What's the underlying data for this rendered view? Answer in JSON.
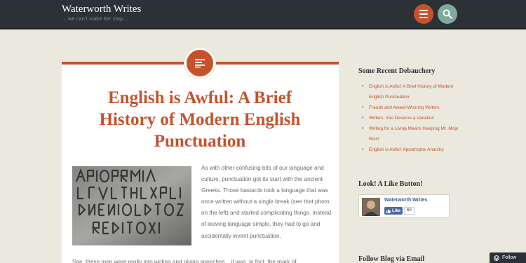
{
  "site": {
    "title": "Waterworth Writes",
    "tagline": "... we can't make her stop...."
  },
  "header": {
    "menu_icon": "menu-icon",
    "search_icon": "search-icon"
  },
  "post": {
    "format_icon": "standard-post-icon",
    "title": "English is Awful: A Brief History of Modern English Punctuation",
    "paragraph_1": "As with other confusing bits of our language and culture, punctuation got its start with the ancient Greeks.  Those bastards took a language that was once written without a single break (see that photo on the left) and started complicating things.  Instead of leaving language simple, they had to go and accidentally invent punctuation.",
    "paragraph_2": "See, these men were really into writing and giving speeches... it was, in fact, the mark of"
  },
  "sidebar": {
    "recent_heading": "Some Recent Debauchery",
    "recent_posts": [
      "English is Awful: A Brief History of Modern English Punctuation",
      "Frauds and Award-Winning Writers",
      "Writers: You Deserve a Vacation",
      "Writing for a Living Means Keeping Mr. Mojo Risin'",
      "English is Awful: Apostrophe Anarchy"
    ],
    "like_heading": "Look! A Like Button!",
    "facebook": {
      "page_name": "Waterworth Writes",
      "like_label": "Like",
      "like_count": "60"
    },
    "follow_heading": "Follow Blog via Email"
  },
  "follow_button": {
    "label": "Follow"
  },
  "colors": {
    "accent": "#c4532d",
    "header_bg": "#2c3136",
    "search_accent": "#7fa99b",
    "page_bg": "#ebe8dd"
  }
}
